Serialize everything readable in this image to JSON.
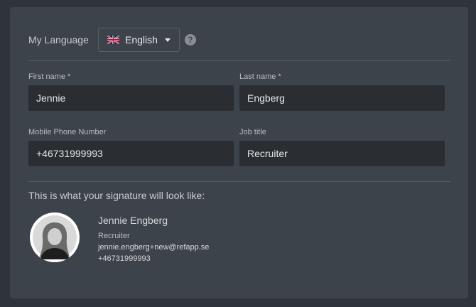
{
  "language": {
    "label": "My Language",
    "selected": "English",
    "help_symbol": "?"
  },
  "form": {
    "first_name": {
      "label": "First name *",
      "value": "Jennie"
    },
    "last_name": {
      "label": "Last name *",
      "value": "Engberg"
    },
    "mobile_phone": {
      "label": "Mobile Phone Number",
      "value": "+46731999993"
    },
    "job_title": {
      "label": "Job title",
      "value": "Recruiter"
    }
  },
  "signature": {
    "heading": "This is what your signature will look like:",
    "name": "Jennie Engberg",
    "title": "Recruiter",
    "email": "jennie.engberg+new@refapp.se",
    "phone": "+46731999993"
  },
  "colors": {
    "panel": "#3d434a",
    "page_bg": "#2f343a",
    "input_bg": "#2a2e33"
  },
  "icons": {
    "flag": "uk-flag-icon",
    "dropdown": "caret-down-icon",
    "help": "question-circle-icon"
  }
}
